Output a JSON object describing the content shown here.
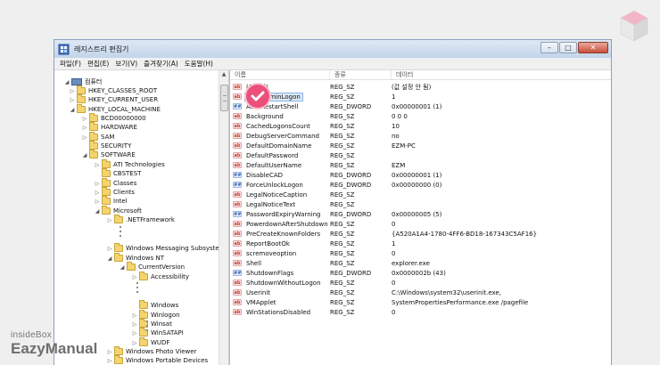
{
  "window": {
    "title": "레지스트리 편집기",
    "controls": {
      "minimize": "–",
      "maximize": "□",
      "close": "✕"
    }
  },
  "menubar": [
    "파일(F)",
    "편집(E)",
    "보기(V)",
    "즐겨찾기(A)",
    "도움말(H)"
  ],
  "tree": {
    "items": [
      {
        "label": "컴퓨터",
        "toggle": "◢",
        "icon": "computer-icon"
      },
      {
        "label": "HKEY_CLASSES_ROOT",
        "toggle": "▷"
      },
      {
        "label": "HKEY_CURRENT_USER",
        "toggle": "▷"
      },
      {
        "label": "HKEY_LOCAL_MACHINE",
        "toggle": "◢"
      },
      {
        "label": "BCD00000000",
        "toggle": "▷"
      },
      {
        "label": "HARDWARE",
        "toggle": "▷"
      },
      {
        "label": "SAM",
        "toggle": "▷"
      },
      {
        "label": "SECURITY",
        "toggle": ""
      },
      {
        "label": "SOFTWARE",
        "toggle": "◢"
      },
      {
        "label": "ATI Technologies",
        "toggle": "▷"
      },
      {
        "label": "CBSTEST",
        "toggle": ""
      },
      {
        "label": "Classes",
        "toggle": "▷"
      },
      {
        "label": "Clients",
        "toggle": "▷"
      },
      {
        "label": "Intel",
        "toggle": "▷"
      },
      {
        "label": "Microsoft",
        "toggle": "◢"
      },
      {
        "label": ".NETFramework",
        "toggle": "▷"
      },
      {
        "label": "Windows Messaging Subsystem",
        "toggle": "▷"
      },
      {
        "label": "Windows NT",
        "toggle": "◢"
      },
      {
        "label": "CurrentVersion",
        "toggle": "◢"
      },
      {
        "label": "Accessibility",
        "toggle": "▷"
      },
      {
        "label": "Windows",
        "toggle": ""
      },
      {
        "label": "Winlogon",
        "toggle": "▷"
      },
      {
        "label": "Winsat",
        "toggle": "▷"
      },
      {
        "label": "WinSATAPI",
        "toggle": "▷"
      },
      {
        "label": "WUDF",
        "toggle": "▷"
      },
      {
        "label": "Windows Photo Viewer",
        "toggle": "▷"
      },
      {
        "label": "Windows Portable Devices",
        "toggle": "▷"
      }
    ]
  },
  "list": {
    "columns": [
      "이름",
      "종류",
      "데이터"
    ],
    "rows": [
      {
        "name": "(기본값)",
        "type": "REG_SZ",
        "data": "(값 설정 안 됨)",
        "kind": "sz"
      },
      {
        "name": "AutoAdminLogon",
        "type": "REG_SZ",
        "data": "1",
        "kind": "sz"
      },
      {
        "name": "AutoRestartShell",
        "type": "REG_DWORD",
        "data": "0x00000001 (1)",
        "kind": "dw"
      },
      {
        "name": "Background",
        "type": "REG_SZ",
        "data": "0 0 0",
        "kind": "sz"
      },
      {
        "name": "CachedLogonsCount",
        "type": "REG_SZ",
        "data": "10",
        "kind": "sz"
      },
      {
        "name": "DebugServerCommand",
        "type": "REG_SZ",
        "data": "no",
        "kind": "sz"
      },
      {
        "name": "DefaultDomainName",
        "type": "REG_SZ",
        "data": "EZM-PC",
        "kind": "sz"
      },
      {
        "name": "DefaultPassword",
        "type": "REG_SZ",
        "data": "",
        "kind": "sz"
      },
      {
        "name": "DefaultUserName",
        "type": "REG_SZ",
        "data": "EZM",
        "kind": "sz"
      },
      {
        "name": "DisableCAD",
        "type": "REG_DWORD",
        "data": "0x00000001 (1)",
        "kind": "dw"
      },
      {
        "name": "ForceUnlockLogon",
        "type": "REG_DWORD",
        "data": "0x00000000 (0)",
        "kind": "dw"
      },
      {
        "name": "LegalNoticeCaption",
        "type": "REG_SZ",
        "data": "",
        "kind": "sz"
      },
      {
        "name": "LegalNoticeText",
        "type": "REG_SZ",
        "data": "",
        "kind": "sz"
      },
      {
        "name": "PasswordExpiryWarning",
        "type": "REG_DWORD",
        "data": "0x00000005 (5)",
        "kind": "dw"
      },
      {
        "name": "PowerdownAfterShutdown",
        "type": "REG_SZ",
        "data": "0",
        "kind": "sz"
      },
      {
        "name": "PreCreateKnownFolders",
        "type": "REG_SZ",
        "data": "{A520A1A4-1780-4FF6-BD18-167343C5AF16}",
        "kind": "sz"
      },
      {
        "name": "ReportBootOk",
        "type": "REG_SZ",
        "data": "1",
        "kind": "sz"
      },
      {
        "name": "scremoveoption",
        "type": "REG_SZ",
        "data": "0",
        "kind": "sz"
      },
      {
        "name": "Shell",
        "type": "REG_SZ",
        "data": "explorer.exe",
        "kind": "sz"
      },
      {
        "name": "ShutdownFlags",
        "type": "REG_DWORD",
        "data": "0x0000002b (43)",
        "kind": "dw"
      },
      {
        "name": "ShutdownWithoutLogon",
        "type": "REG_SZ",
        "data": "0",
        "kind": "sz"
      },
      {
        "name": "Userinit",
        "type": "REG_SZ",
        "data": "C:\\Windows\\system32\\userinit.exe,",
        "kind": "sz"
      },
      {
        "name": "VMApplet",
        "type": "REG_SZ",
        "data": "SystemPropertiesPerformance.exe /pagefile",
        "kind": "sz"
      },
      {
        "name": "WinStationsDisabled",
        "type": "REG_SZ",
        "data": "0",
        "kind": "sz"
      }
    ]
  },
  "type_icons": {
    "sz": "ab",
    "dw": "##"
  },
  "watermark": {
    "line1": "insideBox",
    "line2": "EazyManual"
  },
  "colors": {
    "accent": "#ec4f7c",
    "selection": "#dce9f7"
  }
}
